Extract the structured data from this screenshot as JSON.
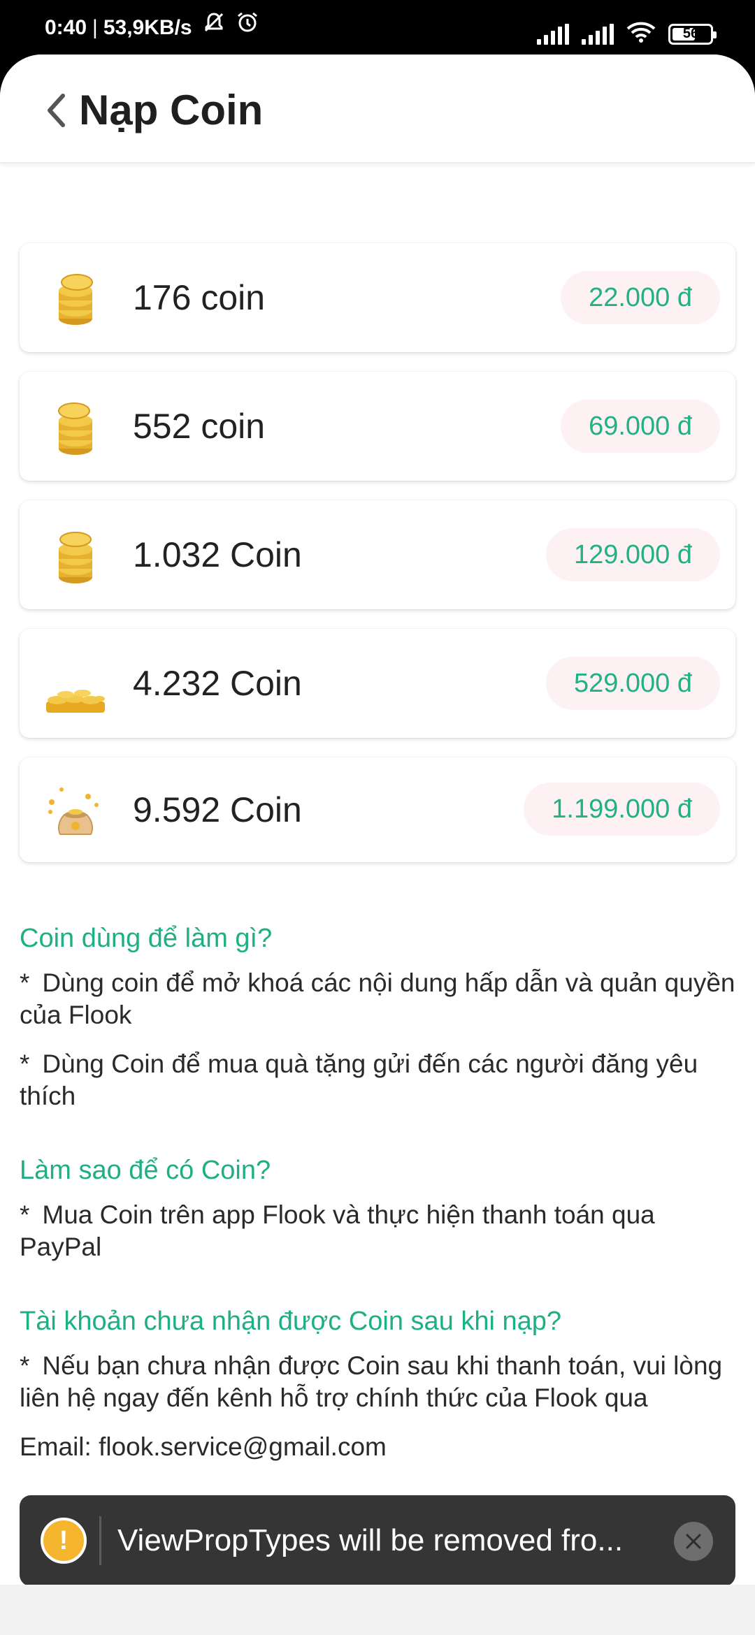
{
  "status_bar": {
    "time": "0:40",
    "network_speed": "53,9KB/s",
    "battery": "56",
    "icons": [
      "mute-icon",
      "alarm-icon",
      "signal-icon",
      "signal-icon",
      "wifi-icon",
      "battery-icon"
    ]
  },
  "header": {
    "back_icon": "chevron-left-icon",
    "title": "Nạp Coin"
  },
  "packages": [
    {
      "label": "176 coin",
      "price": "22.000 đ",
      "icon": "coin-stack-icon"
    },
    {
      "label": "552 coin",
      "price": "69.000 đ",
      "icon": "coin-stack-icon"
    },
    {
      "label": "1.032 Coin",
      "price": "129.000 đ",
      "icon": "coin-stack-icon"
    },
    {
      "label": "4.232 Coin",
      "price": "529.000 đ",
      "icon": "coin-pile-icon"
    },
    {
      "label": "9.592 Coin",
      "price": "1.199.000 đ",
      "icon": "coin-bag-icon"
    }
  ],
  "faq": [
    {
      "question": "Coin dùng để làm gì?",
      "answers": [
        "Dùng coin để mở khoá các nội dung hấp dẫn và quản quyền của Flook",
        "Dùng Coin để mua quà tặng gửi đến các người đăng yêu thích"
      ]
    },
    {
      "question": "Làm sao để có Coin?",
      "answers": [
        "Mua Coin trên app Flook và thực hiện thanh toán qua PayPal"
      ]
    },
    {
      "question": "Tài khoản chưa nhận được Coin sau khi nạp?",
      "answers": [
        "Nếu bạn chưa nhận được Coin sau khi thanh toán, vui lòng liên hệ ngay đến kênh hỗ trợ chính thức của Flook qua",
        "Email: flook.service@gmail.com"
      ]
    }
  ],
  "toast": {
    "icon": "warning-icon",
    "message": "ViewPropTypes will be removed fro...",
    "close_icon": "close-icon"
  },
  "colors": {
    "accent_green": "#1eaf84",
    "price_bg": "#fdf1f4",
    "toast_bg": "#353535",
    "warning": "#f5b52e"
  }
}
